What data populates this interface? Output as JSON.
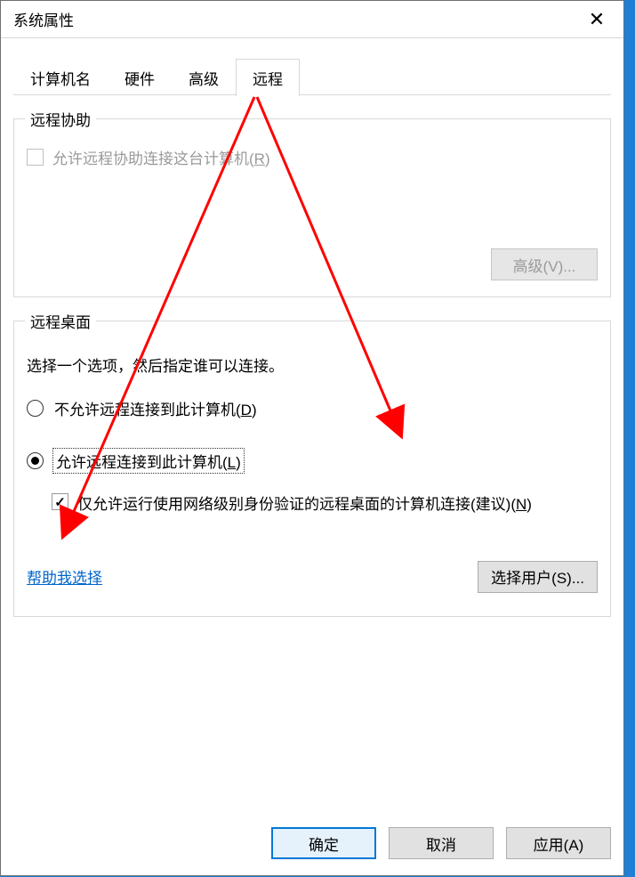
{
  "titlebar": {
    "title": "系统属性",
    "close": "✕"
  },
  "tabs": {
    "computer_name": "计算机名",
    "hardware": "硬件",
    "advanced": "高级",
    "remote": "远程"
  },
  "remote_assist": {
    "legend": "远程协助",
    "allow_label_pre": "允许远程协助连接这台计算机(",
    "allow_hotkey": "R",
    "allow_label_post": ")",
    "advanced_btn_pre": "高级(",
    "advanced_btn_hotkey": "V",
    "advanced_btn_post": ")..."
  },
  "remote_desktop": {
    "legend": "远程桌面",
    "desc": "选择一个选项，然后指定谁可以连接。",
    "opt_disallow_pre": "不允许远程连接到此计算机(",
    "opt_disallow_hotkey": "D",
    "opt_disallow_post": ")",
    "opt_allow_pre": "允许远程连接到此计算机(",
    "opt_allow_hotkey": "L",
    "opt_allow_post": ")",
    "nla_pre": "仅允许运行使用网络级别身份验证的远程桌面的计算机连接(建议)(",
    "nla_hotkey": "N",
    "nla_post": ")",
    "help_link": "帮助我选择",
    "select_users_pre": "选择用户(",
    "select_users_hotkey": "S",
    "select_users_post": ")..."
  },
  "buttons": {
    "ok": "确定",
    "cancel": "取消",
    "apply_pre": "应用(",
    "apply_hotkey": "A",
    "apply_post": ")"
  }
}
